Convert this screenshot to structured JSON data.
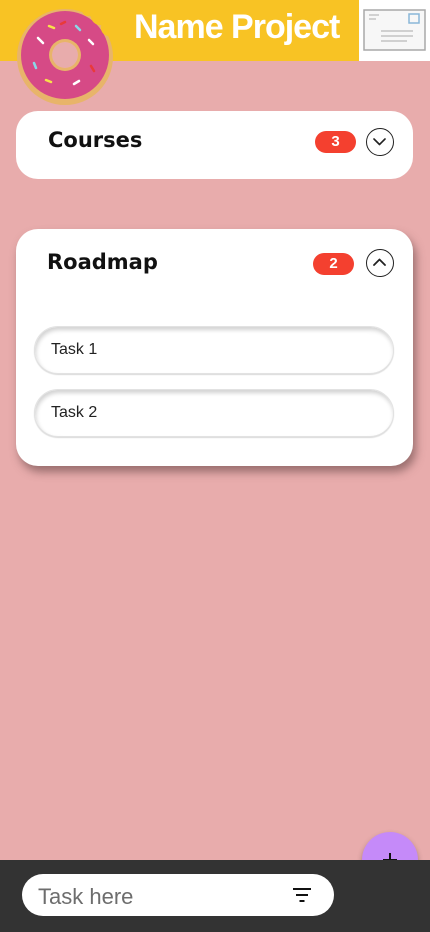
{
  "header": {
    "title": "Name Project",
    "logo_icon": "donut-icon",
    "mail_icon": "envelope-icon",
    "background_color": "#f8c324"
  },
  "groups": [
    {
      "title": "Courses",
      "count": "3",
      "expanded": false,
      "toggle_icon": "chevron-down-icon"
    },
    {
      "title": "Roadmap",
      "count": "2",
      "expanded": true,
      "toggle_icon": "chevron-up-icon",
      "tasks": [
        {
          "label": "Task 1"
        },
        {
          "label": "Task 2"
        }
      ]
    }
  ],
  "composer": {
    "placeholder": "Task here",
    "value": "",
    "filter_icon": "filter-icon"
  },
  "fab": {
    "icon": "plus-icon",
    "color": "#c58af9"
  },
  "colors": {
    "background": "#e8acac",
    "badge": "#f4402f",
    "bottom_bar": "#333333"
  }
}
